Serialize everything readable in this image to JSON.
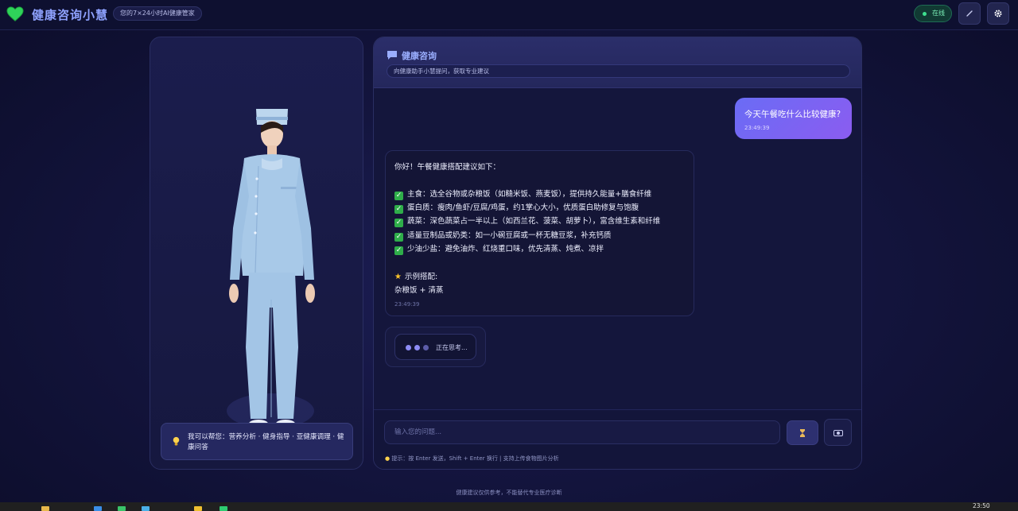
{
  "header": {
    "title": "健康咨询小慧",
    "subtitle": "您的7×24小时AI健康管家",
    "status": "在线",
    "icons": [
      "heart-logo-icon",
      "wrench-icon",
      "gear-icon"
    ]
  },
  "avatar_panel": {
    "help_text": "我可以帮您：营养分析 · 健身指导 · 亚健康调理 · 健康问答"
  },
  "chat": {
    "title": "健康咨询",
    "subtitle": "向健康助手小慧提问，获取专业建议",
    "messages": {
      "user": {
        "text": "今天午餐吃什么比较健康?",
        "time": "23:49:39"
      },
      "bot": {
        "greeting": "你好！午餐健康搭配建议如下：",
        "items": [
          "主食：选全谷物或杂粮饭（如糙米饭、燕麦饭），提供持久能量+膳食纤维",
          "蛋白质：瘦肉/鱼虾/豆腐/鸡蛋，约1掌心大小，优质蛋白助修复与饱腹",
          "蔬菜：深色蔬菜占一半以上（如西兰花、菠菜、胡萝卜），富含维生素和纤维",
          "适量豆制品或奶类：如一小碗豆腐或一杯无糖豆浆，补充钙质",
          "少油少盐：避免油炸、红烧重口味，优先清蒸、炖煮、凉拌"
        ],
        "example_title": "示例搭配:",
        "example_text": "杂粮饭 + 清蒸",
        "time": "23:49:39"
      },
      "thinking": "正在思考..."
    },
    "input": {
      "placeholder": "输入您的问题...",
      "hint": "提示：按 Enter 发送，Shift + Enter 换行 | 支持上传食物图片分析"
    }
  },
  "footer": "健康建议仅供参考，不能替代专业医疗诊断",
  "taskbar": {
    "clock": "23:50"
  },
  "colors": {
    "accent": "#8b5cf0",
    "brand": "#8fa2ff",
    "online": "#3ee08f"
  }
}
